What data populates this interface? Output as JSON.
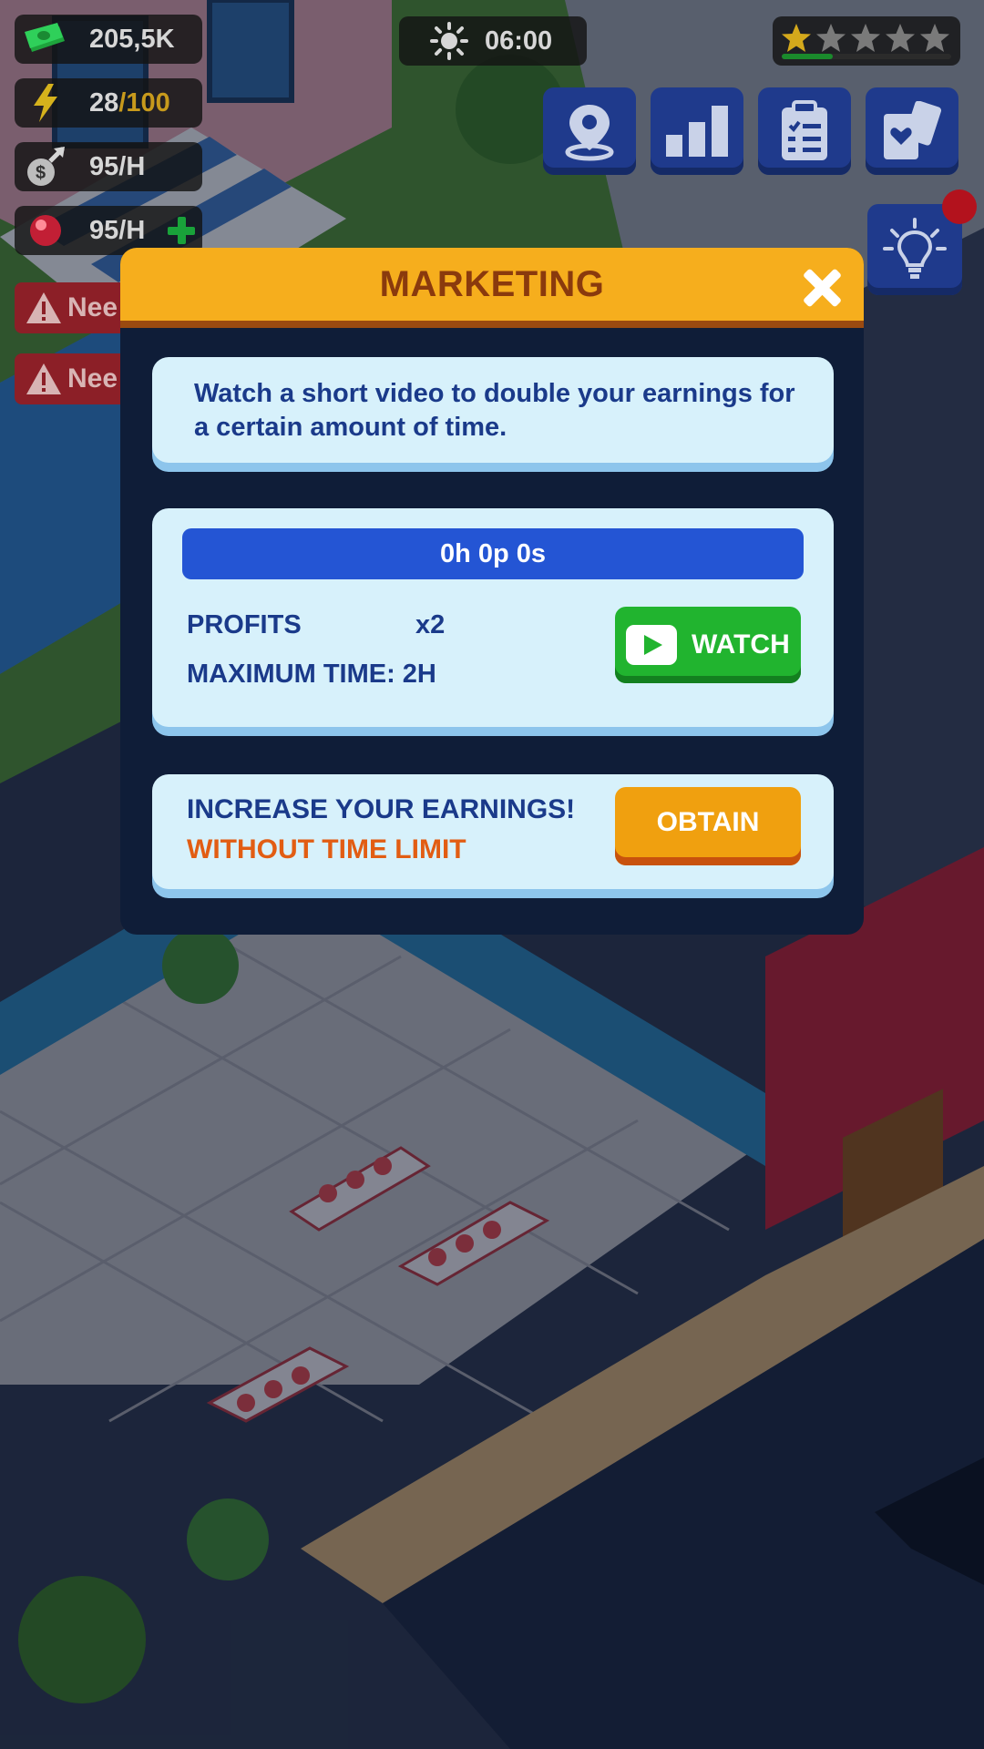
{
  "hud": {
    "money": "205,5K",
    "energy_current": "28",
    "energy_separator": "/",
    "energy_max": "100",
    "income_rate": "95/H",
    "gems_rate": "95/H",
    "time": "06:00",
    "stars_filled": 1,
    "stars_total": 5,
    "star_progress": 0.3,
    "warnings": [
      "Nee",
      "Nee"
    ]
  },
  "menu": {
    "buttons": [
      "map-pin-icon",
      "stats-bars-icon",
      "clipboard-icon",
      "cards-icon"
    ],
    "tip_icon": "lightbulb-icon"
  },
  "modal": {
    "title": "MARKETING",
    "description": "Watch a short video to double your earnings for a certain amount of time.",
    "timer": "0h 0p 0s",
    "profits_label": "PROFITS",
    "profits_value": "x2",
    "max_time_label": "MAXIMUM TIME: 2H",
    "watch_label": "WATCH",
    "promo_line1": "INCREASE YOUR EARNINGS!",
    "promo_line2": "WITHOUT TIME LIMIT",
    "obtain_label": "OBTAIN"
  },
  "colors": {
    "header": "#f6ae1d",
    "title": "#8a3a0d",
    "modal_bg": "#0f1d38",
    "card_bg": "#d7f1fb",
    "timer_bar": "#2455d4",
    "watch_green": "#21b42f",
    "obtain_orange": "#f0a00f",
    "promo_orange": "#e25d13"
  }
}
